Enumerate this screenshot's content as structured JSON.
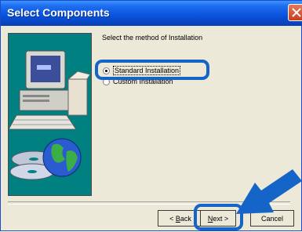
{
  "window": {
    "title": "Select Components"
  },
  "content": {
    "prompt": "Select the method of Installation",
    "options": [
      {
        "label": "Standard Installation",
        "selected": true
      },
      {
        "label": "Custom Installation",
        "selected": false
      }
    ]
  },
  "buttons": {
    "back": {
      "mnemonic": "B",
      "rest": "ack",
      "prefix": "< "
    },
    "next": {
      "mnemonic": "N",
      "rest": "ext >"
    },
    "cancel": "Cancel"
  },
  "colors": {
    "titlebar": "#0a55e0",
    "highlight": "#1565c8",
    "illustration_bg": "#008080"
  },
  "icons": [
    "close-icon",
    "computer-icon",
    "cd-icon",
    "globe-icon",
    "pointer-arrow"
  ]
}
